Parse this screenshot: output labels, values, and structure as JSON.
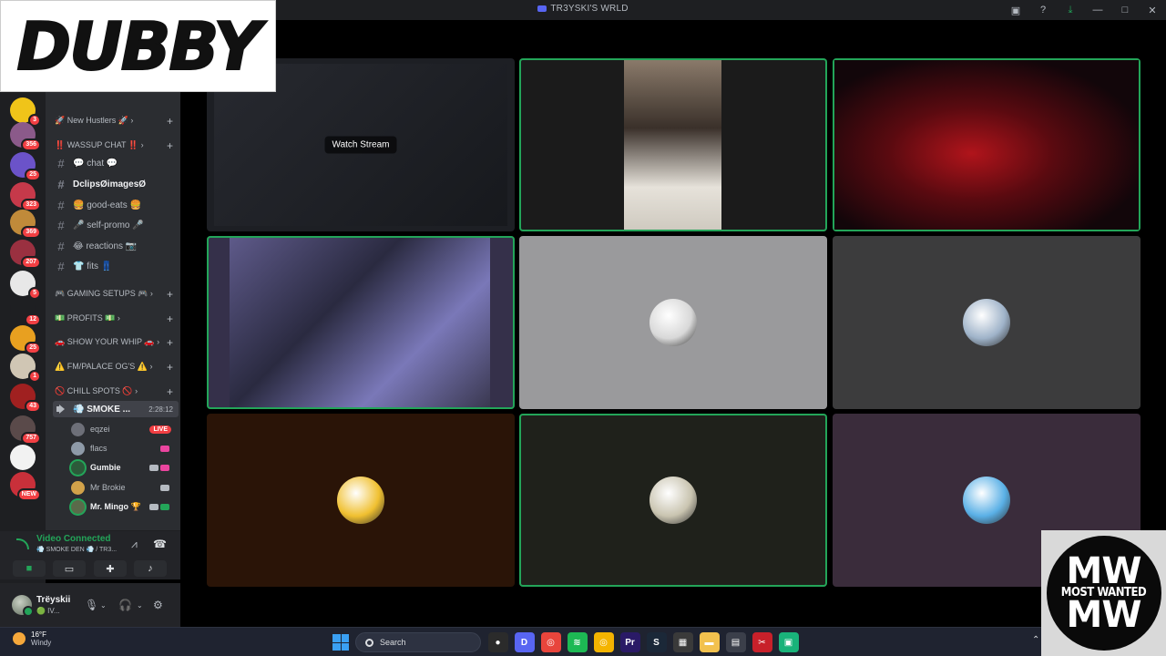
{
  "window": {
    "title": "TR3YSKI'S WRLD"
  },
  "overlays": {
    "left_logo": "DUBBY",
    "right_logo_big": "MW",
    "right_logo_text": "MOST WANTED"
  },
  "servers": [
    {
      "badge": "3",
      "color": "#f0c419"
    },
    {
      "badge": "356",
      "color": "#8b5a8a"
    },
    {
      "badge": "25",
      "color": "#6b53c9"
    },
    {
      "badge": "323",
      "color": "#c6394a"
    },
    {
      "badge": "369",
      "color": "#c08a3a"
    },
    {
      "badge": "207",
      "color": "#9a3040"
    },
    {
      "badge": "5",
      "color": "#e8e8e8"
    },
    {
      "badge": "12",
      "color": "#1e1f22"
    },
    {
      "badge": "25",
      "color": "#e8a020"
    },
    {
      "badge": "1",
      "color": "#d0c6b4"
    },
    {
      "badge": "43",
      "color": "#a02020"
    },
    {
      "badge": "757",
      "color": "#5a4a4a"
    },
    {
      "badge": "",
      "color": "#f2f2f2"
    },
    {
      "badge": "NEW",
      "color": "#c9303a"
    }
  ],
  "channels": {
    "categories": [
      {
        "label": "🚀 New Hustlers 🚀 ›"
      },
      {
        "label": "‼️ WASSUP CHAT ‼️ ›"
      },
      {
        "label": "🎮 GAMING SETUPS 🎮 ›"
      },
      {
        "label": "💵 PROFITS 💵 ›"
      },
      {
        "label": "🚗 SHOW YOUR WHIP 🚗 ›"
      },
      {
        "label": "⚠️ FM/PALACE OG'S ⚠️ ›"
      },
      {
        "label": "🚫 CHILL SPOTS 🚫 ›"
      }
    ],
    "text_channels": [
      {
        "label": "💬 chat 💬"
      },
      {
        "label": "DclipsØimagesØ"
      },
      {
        "label": "🍔 good-eats 🍔"
      },
      {
        "label": "🎤 self-promo 🎤"
      },
      {
        "label": "😂 reactions 📷"
      },
      {
        "label": "👕 fits 👖"
      }
    ],
    "voice_channel": {
      "label": "💨 SMOKE ...",
      "time": "2:28:12"
    },
    "voice_users": [
      {
        "name": "eqzei",
        "live": "LIVE",
        "color": "#6d6f78"
      },
      {
        "name": "flacs",
        "color": "#8e9aa8"
      },
      {
        "name": "Gumbie",
        "color": "#2c5a3a"
      },
      {
        "name": "Mr Brokie",
        "color": "#d2a24a"
      },
      {
        "name": "Mr. Mingo 🏆",
        "color": "#5a6a4a"
      }
    ]
  },
  "voice_panel": {
    "status": "Video Connected",
    "location": "💨 SMOKE DEN 💨 / TR3...",
    "buttons": [
      "camera-button",
      "screen-share-button",
      "activities-button",
      "soundboard-button"
    ]
  },
  "user_panel": {
    "name": "Trëyskii",
    "sub": "🟢 IV..."
  },
  "tiles": [
    {
      "name": "stream-tile",
      "label": "Watch Stream",
      "bg": "#1d1f24",
      "speaking": false
    },
    {
      "name": "camera-tile-2",
      "bg": "#1b1b1b",
      "speaking": true
    },
    {
      "name": "camera-tile-3",
      "bg": "#1a0508",
      "speaking": true
    },
    {
      "name": "camera-tile-4",
      "bg": "#35304a",
      "speaking": true
    },
    {
      "name": "avatar-tile-5",
      "bg": "#9a9a9c",
      "speaking": false,
      "avatar": "#d8d8d8"
    },
    {
      "name": "avatar-tile-6",
      "bg": "#3c3c3d",
      "speaking": false,
      "avatar": "#9fb3c9"
    },
    {
      "name": "avatar-tile-7",
      "bg": "#2a1407",
      "speaking": false,
      "avatar": "#f0c030"
    },
    {
      "name": "avatar-tile-8",
      "bg": "#1f211b",
      "speaking": true,
      "avatar": "#c9c4b0"
    },
    {
      "name": "avatar-tile-9",
      "bg": "#3a2c3b",
      "speaking": false,
      "avatar": "#5ab0e6"
    }
  ],
  "taskbar": {
    "temp": "16°F",
    "weather": "Windy",
    "search_label": "Search",
    "apps": [
      {
        "name": "obs-app",
        "color": "#2b2b2b",
        "glyph": "●"
      },
      {
        "name": "discord-app",
        "color": "#5865f2",
        "glyph": "D"
      },
      {
        "name": "chrome-app",
        "color": "#e8453c",
        "glyph": "◎"
      },
      {
        "name": "spotify-app",
        "color": "#1db954",
        "glyph": "≋"
      },
      {
        "name": "chrome2-app",
        "color": "#f4b400",
        "glyph": "◎"
      },
      {
        "name": "premiere-app",
        "color": "#2a1a66",
        "glyph": "Pr"
      },
      {
        "name": "steam-app",
        "color": "#1b2838",
        "glyph": "S"
      },
      {
        "name": "controller-app",
        "color": "#3a3a3a",
        "glyph": "▦"
      },
      {
        "name": "explorer-app",
        "color": "#f2c14e",
        "glyph": "▬"
      },
      {
        "name": "store-app",
        "color": "#3b3f4a",
        "glyph": "▤"
      },
      {
        "name": "capcut-app",
        "color": "#c8202a",
        "glyph": "✂"
      },
      {
        "name": "app-green",
        "color": "#19b37a",
        "glyph": "▣"
      }
    ]
  }
}
